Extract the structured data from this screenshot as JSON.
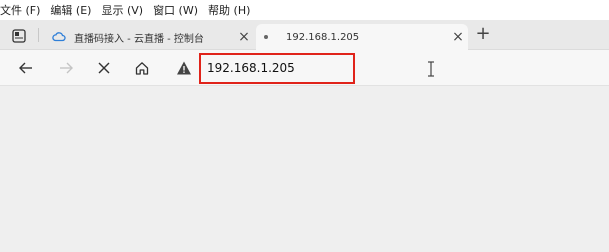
{
  "menubar": {
    "items": [
      "文件 (F)",
      "编辑 (E)",
      "显示 (V)",
      "窗口 (W)",
      "帮助 (H)"
    ]
  },
  "tabs": [
    {
      "title": "直播码接入 - 云直播 - 控制台",
      "close": "×",
      "favicon": "cloud-icon"
    },
    {
      "title": "192.168.1.205",
      "close": "×"
    }
  ],
  "new_tab_label": "+",
  "address_bar": {
    "url": "192.168.1.205",
    "security": "warning-icon",
    "highlight_color": "#e0231a"
  }
}
